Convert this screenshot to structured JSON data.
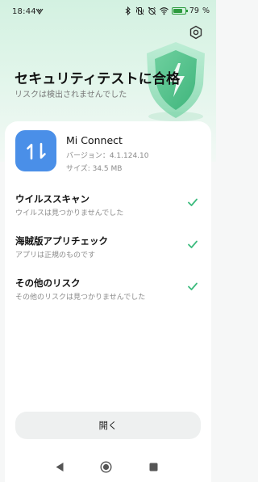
{
  "status_bar": {
    "time": "18:44",
    "battery_percent": "79",
    "battery_level": 0.79
  },
  "header": {
    "title": "セキュリティテストに合格",
    "subtitle": "リスクは検出されませんでした"
  },
  "app": {
    "name": "Mi Connect",
    "version": "バージョン：4.1.124.10",
    "size": "サイズ: 34.5 MB",
    "icon_color": "#4a8fe8"
  },
  "checks": [
    {
      "title": "ウイルススキャン",
      "desc": "ウイルスは見つかりませんでした"
    },
    {
      "title": "海賊版アプリチェック",
      "desc": "アプリは正規のものです"
    },
    {
      "title": "その他のリスク",
      "desc": "その他のリスクは見つかりませんでした"
    }
  ],
  "actions": {
    "open_label": "開く"
  },
  "colors": {
    "accent_green": "#3dbb7e",
    "battery_green": "#2d9b3e"
  }
}
